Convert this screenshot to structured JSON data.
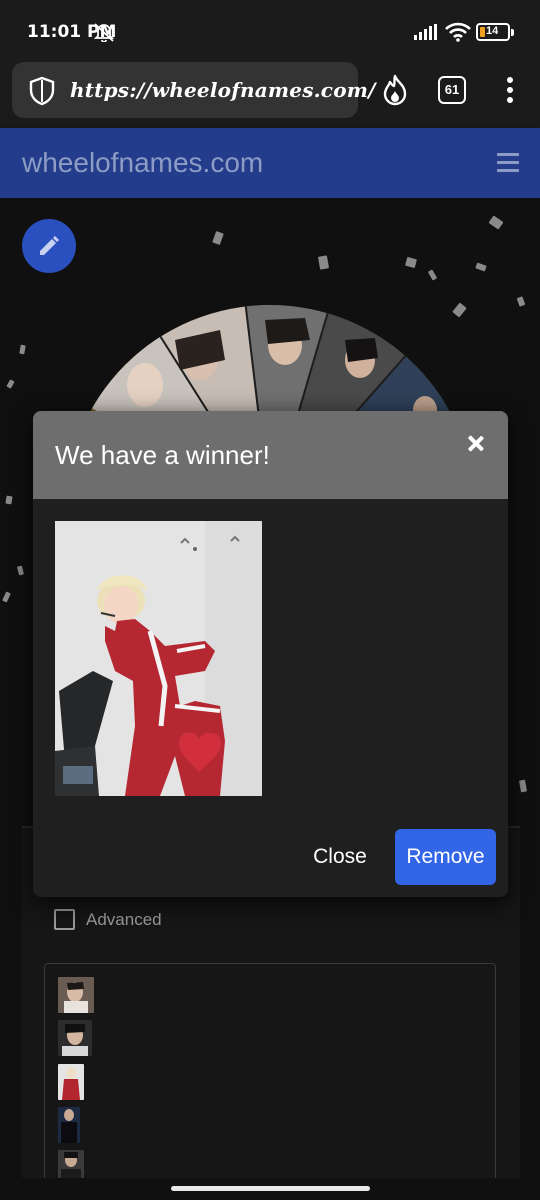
{
  "status_bar": {
    "time": "11:01 PM",
    "battery": "14"
  },
  "browser": {
    "url": "https://wheelofnames.com/",
    "tab_count": "61"
  },
  "site": {
    "title": "wheelofnames.com"
  },
  "panel": {
    "advanced_label": "Advanced",
    "advanced_checked": false
  },
  "modal": {
    "title": "We have a winner!",
    "close_label": "Close",
    "remove_label": "Remove"
  },
  "colors": {
    "header_bg": "#233d8c",
    "accent": "#3366e6",
    "modal_header": "#6e6e6e",
    "modal_body": "#1f1f1f"
  },
  "icons": [
    "shield-icon",
    "fire-icon",
    "tabs-icon",
    "more-vert-icon",
    "menu-icon",
    "pencil-icon",
    "close-icon",
    "checkbox-icon",
    "mute-icon",
    "signal-icon",
    "wifi-icon",
    "battery-icon"
  ]
}
